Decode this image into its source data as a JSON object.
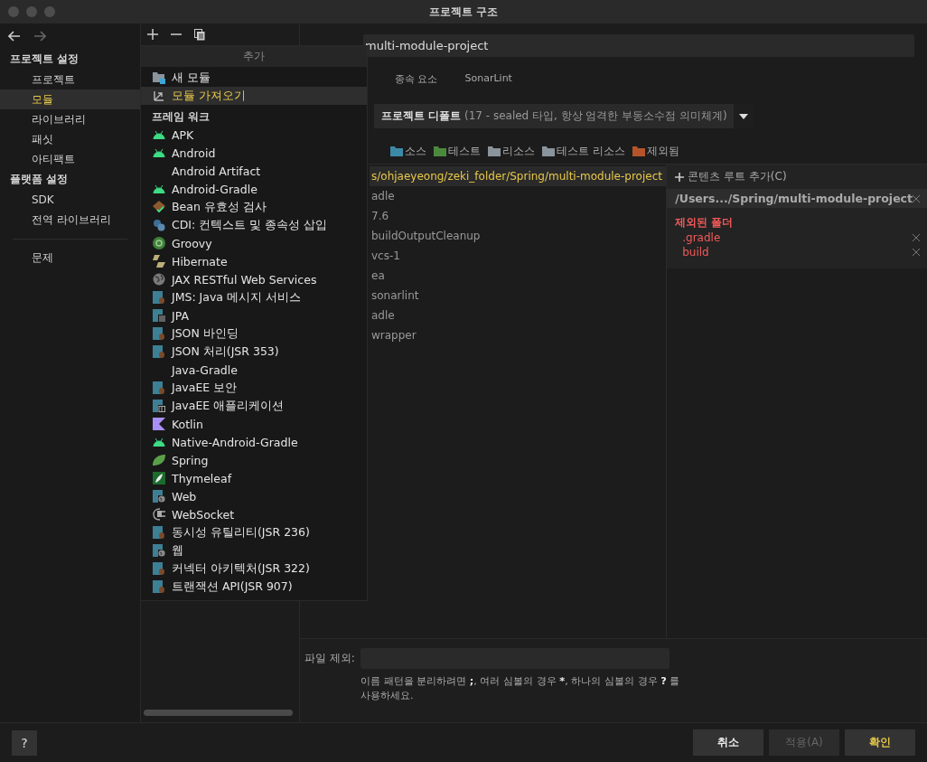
{
  "window": {
    "title": "프로젝트 구조"
  },
  "sidebar": {
    "groups": [
      {
        "heading": "프로젝트 설정",
        "items": [
          {
            "label": "프로젝트",
            "selected": false
          },
          {
            "label": "모듈",
            "selected": true
          },
          {
            "label": "라이브러리",
            "selected": false
          },
          {
            "label": "패싯",
            "selected": false
          },
          {
            "label": "아티팩트",
            "selected": false
          }
        ]
      },
      {
        "heading": "플랫폼 설정",
        "items": [
          {
            "label": "SDK",
            "selected": false
          },
          {
            "label": "전역 라이브러리",
            "selected": false
          }
        ]
      }
    ],
    "footer_items": [
      {
        "label": "문제",
        "selected": false
      }
    ]
  },
  "popup": {
    "title": "추가",
    "actions": [
      {
        "label": "새 모듈",
        "kind": "folder",
        "selected": false
      },
      {
        "label": "모듈 가져오기",
        "kind": "import",
        "selected": true
      }
    ],
    "section": "프레임 워크",
    "items": [
      {
        "label": "APK",
        "kind": "android"
      },
      {
        "label": "Android",
        "kind": "android"
      },
      {
        "label": "Android Artifact",
        "kind": "none"
      },
      {
        "label": "Android-Gradle",
        "kind": "android"
      },
      {
        "label": "Bean 유효성 검사",
        "kind": "bean"
      },
      {
        "label": "CDI: 컨텍스트 및 종속성 삽입",
        "kind": "cdi"
      },
      {
        "label": "Groovy",
        "kind": "groovy"
      },
      {
        "label": "Hibernate",
        "kind": "hibernate"
      },
      {
        "label": "JAX RESTful Web Services",
        "kind": "globe"
      },
      {
        "label": "JMS: Java 메시지 서비스",
        "kind": "javaee"
      },
      {
        "label": "JPA",
        "kind": "jpa"
      },
      {
        "label": "JSON 바인딩",
        "kind": "javaee"
      },
      {
        "label": "JSON 처리(JSR 353)",
        "kind": "javaee"
      },
      {
        "label": "Java-Gradle",
        "kind": "none"
      },
      {
        "label": "JavaEE 보안",
        "kind": "javaee"
      },
      {
        "label": "JavaEE 애플리케이션",
        "kind": "app"
      },
      {
        "label": "Kotlin",
        "kind": "kotlin"
      },
      {
        "label": "Native-Android-Gradle",
        "kind": "android"
      },
      {
        "label": "Spring",
        "kind": "spring"
      },
      {
        "label": "Thymeleaf",
        "kind": "thymeleaf"
      },
      {
        "label": "Web",
        "kind": "web"
      },
      {
        "label": "WebSocket",
        "kind": "websocket"
      },
      {
        "label": "동시성 유틸리티(JSR 236)",
        "kind": "javaee"
      },
      {
        "label": "웹",
        "kind": "web"
      },
      {
        "label": "커넥터 아키텍처(JSR 322)",
        "kind": "javaee"
      },
      {
        "label": "트랜잭션 API(JSR 907)",
        "kind": "javaee"
      }
    ]
  },
  "module": {
    "name": "multi-module-project",
    "tabs": [
      {
        "label": "종속 요소",
        "selected": false
      },
      {
        "label": "SonarLint",
        "selected": false
      }
    ],
    "language_level": "**프로젝트 디폴트** (17 - sealed 타입, 항상 엄격한 부동소수점 의미체계)",
    "markers": [
      {
        "label": "소스",
        "color": "#3d8aa8"
      },
      {
        "label": "테스트",
        "color": "#4b8a3c"
      },
      {
        "label": "리소스",
        "color": "#8a949c"
      },
      {
        "label": "테스트 리소스",
        "color": "#8a949c"
      },
      {
        "label": "제외됨",
        "color": "#b5542a"
      }
    ],
    "tree": [
      {
        "label": "s/ohjaeyeong/zeki_folder/Spring/multi-module-project",
        "selected": true
      },
      {
        "label": "adle",
        "selected": false
      },
      {
        "label": "7.6",
        "selected": false
      },
      {
        "label": "buildOutputCleanup",
        "selected": false
      },
      {
        "label": "vcs-1",
        "selected": false
      },
      {
        "label": "ea",
        "selected": false
      },
      {
        "label": "sonarlint",
        "selected": false
      },
      {
        "label": "adle",
        "selected": false
      },
      {
        "label": "wrapper",
        "selected": false
      }
    ],
    "content_root": {
      "add_label": "콘텐츠 루트 추가(C)",
      "path": "/Users.../Spring/multi-module-project",
      "excluded_title": "제외된 폴더",
      "excluded": [
        ".gradle",
        "build"
      ]
    },
    "exclude_label": "파일 제외:",
    "exclude_hint": "이름 패턴을 분리하려면 **;**, 여러 심볼의 경우 *****, 하나의 심볼의 경우 **?** 를 사용하세요."
  },
  "buttons": [
    {
      "label": "취소",
      "kind": "normal",
      "disabled": false
    },
    {
      "label": "적용(A)",
      "kind": "normal",
      "disabled": true
    },
    {
      "label": "확인",
      "kind": "default",
      "disabled": false
    }
  ],
  "help": "?"
}
